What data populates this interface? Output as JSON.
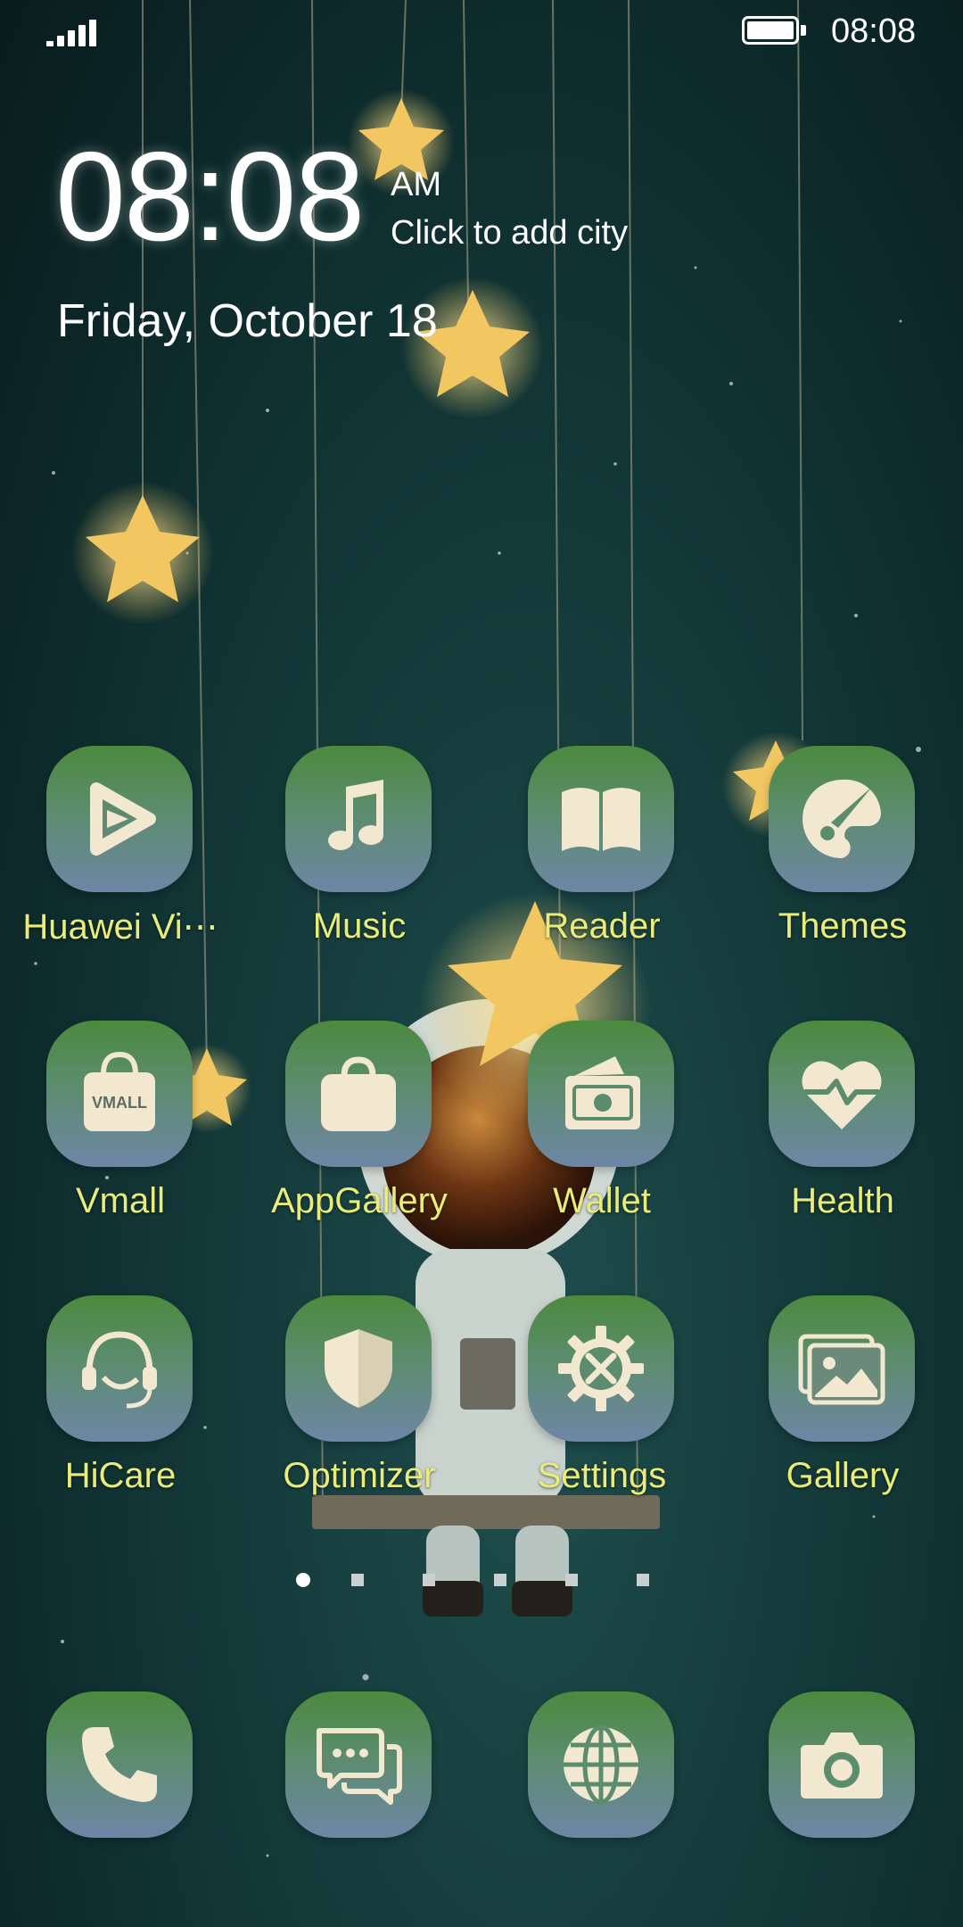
{
  "status_bar": {
    "signal_icon": "signal-icon",
    "battery_icon": "battery-icon",
    "time": "08:08"
  },
  "clock_widget": {
    "time": "08:08",
    "ampm": "AM",
    "city_prompt": "Click to add city",
    "date": "Friday, October 18"
  },
  "apps": [
    {
      "label": "Huawei Vi⋯",
      "icon": "video-play-icon"
    },
    {
      "label": "Music",
      "icon": "music-note-icon"
    },
    {
      "label": "Reader",
      "icon": "book-icon"
    },
    {
      "label": "Themes",
      "icon": "paintbrush-icon"
    },
    {
      "label": "Vmall",
      "icon": "shopping-bag-icon",
      "icon_text": "VMALL"
    },
    {
      "label": "AppGallery",
      "icon": "briefcase-icon"
    },
    {
      "label": "Wallet",
      "icon": "wallet-icon"
    },
    {
      "label": "Health",
      "icon": "heart-icon"
    },
    {
      "label": "HiCare",
      "icon": "headset-agent-icon"
    },
    {
      "label": "Optimizer",
      "icon": "shield-icon"
    },
    {
      "label": "Settings",
      "icon": "gear-tools-icon"
    },
    {
      "label": "Gallery",
      "icon": "photo-icon"
    }
  ],
  "page_indicator": {
    "pages": 6,
    "current": 1
  },
  "dock": [
    {
      "name": "phone",
      "icon": "phone-icon"
    },
    {
      "name": "messages",
      "icon": "messages-icon"
    },
    {
      "name": "browser",
      "icon": "globe-icon"
    },
    {
      "name": "camera",
      "icon": "camera-icon"
    }
  ],
  "colors": {
    "label": "#e9ec7a",
    "icon_tile_top": "#4b8a3e",
    "icon_tile_bottom": "#6e86a6",
    "glyph": "#f1e8cf",
    "wallpaper": "#133838"
  }
}
